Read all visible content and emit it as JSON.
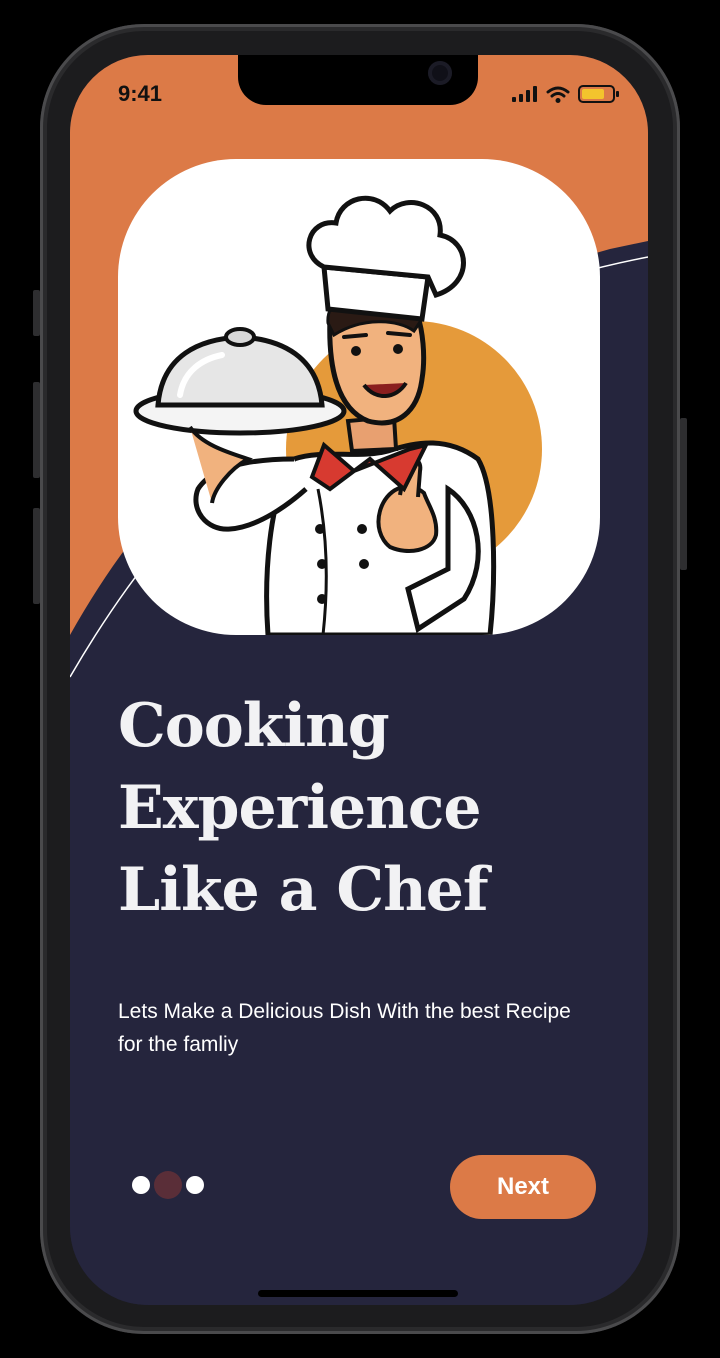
{
  "status_bar": {
    "time": "9:41"
  },
  "hero": {
    "image_icon": "chef-holding-cloche-illustration"
  },
  "onboarding": {
    "title": "Cooking\nExperience\nLike a Chef",
    "subtitle": "Lets Make a Delicious Dish With the best Recipe for the famliy",
    "pagination": {
      "total_pages": 3,
      "current_page": 2
    },
    "next_label": "Next"
  },
  "colors": {
    "accent_orange": "#dc7a47",
    "navy_background": "#25253d",
    "active_dot": "#5a2e38",
    "chef_circle": "#e59a3a"
  }
}
